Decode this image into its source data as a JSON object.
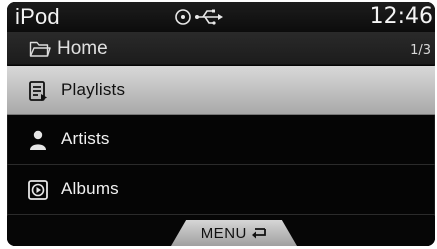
{
  "status_bar": {
    "app_title": "iPod",
    "icons": [
      "disc-icon",
      "usb-icon"
    ],
    "clock": "12:46"
  },
  "breadcrumb": {
    "icon": "folder-icon",
    "label": "Home",
    "page": "1/3"
  },
  "menu": {
    "items": [
      {
        "label": "Playlists",
        "icon": "playlist-icon",
        "selected": true
      },
      {
        "label": "Artists",
        "icon": "artist-icon",
        "selected": false
      },
      {
        "label": "Albums",
        "icon": "album-icon",
        "selected": false
      }
    ]
  },
  "bottom_bar": {
    "menu_label": "MENU",
    "menu_icon": "return-icon"
  },
  "colors": {
    "background": "#050505",
    "text": "#f2f2f2",
    "selection": "#c3c3c3",
    "selected_text": "#111111"
  }
}
